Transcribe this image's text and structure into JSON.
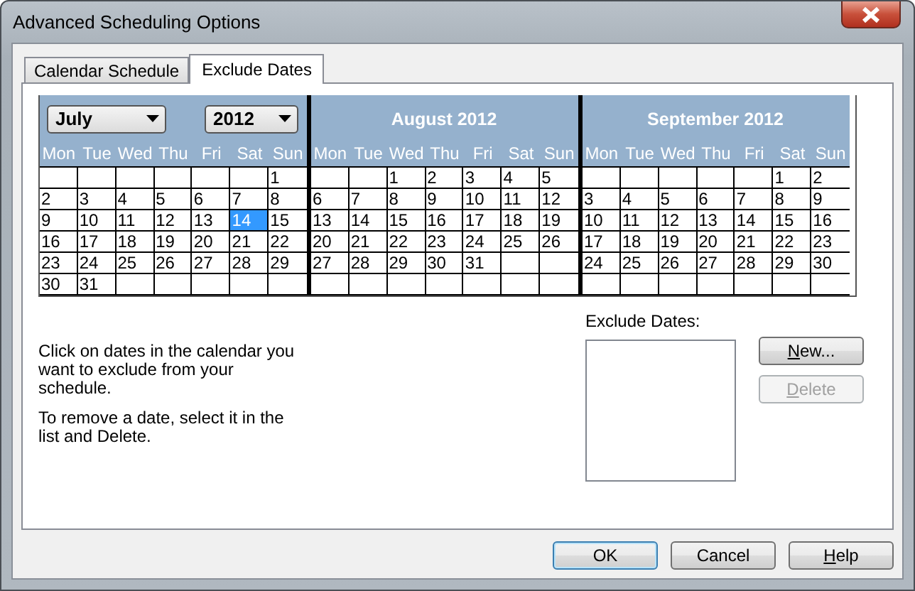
{
  "window": {
    "title": "Advanced Scheduling Options"
  },
  "tabs": [
    {
      "label": "Calendar Schedule",
      "selected": false
    },
    {
      "label": "Exclude Dates",
      "selected": true
    }
  ],
  "calendar": {
    "months": [
      {
        "kind": "picker",
        "month_dropdown": "July",
        "year_dropdown": "2012",
        "weekdays": [
          "Mon",
          "Tue",
          "Wed",
          "Thu",
          "Fri",
          "Sat",
          "Sun"
        ],
        "weeks": [
          [
            {
              "kind": "blank"
            },
            {
              "kind": "blank"
            },
            {
              "kind": "blank"
            },
            {
              "kind": "blank"
            },
            {
              "kind": "blank"
            },
            {
              "kind": "blank"
            },
            {
              "kind": "day",
              "d": "1",
              "selected": false
            }
          ],
          [
            {
              "kind": "day",
              "d": "2",
              "selected": false
            },
            {
              "kind": "day",
              "d": "3",
              "selected": false
            },
            {
              "kind": "day",
              "d": "4",
              "selected": false
            },
            {
              "kind": "day",
              "d": "5",
              "selected": false
            },
            {
              "kind": "day",
              "d": "6",
              "selected": false
            },
            {
              "kind": "day",
              "d": "7",
              "selected": false
            },
            {
              "kind": "day",
              "d": "8",
              "selected": false
            }
          ],
          [
            {
              "kind": "day",
              "d": "9",
              "selected": false
            },
            {
              "kind": "day",
              "d": "10",
              "selected": false
            },
            {
              "kind": "day",
              "d": "11",
              "selected": false
            },
            {
              "kind": "day",
              "d": "12",
              "selected": false
            },
            {
              "kind": "day",
              "d": "13",
              "selected": false
            },
            {
              "kind": "day",
              "d": "14",
              "selected": true
            },
            {
              "kind": "day",
              "d": "15",
              "selected": false
            }
          ],
          [
            {
              "kind": "day",
              "d": "16",
              "selected": false
            },
            {
              "kind": "day",
              "d": "17",
              "selected": false
            },
            {
              "kind": "day",
              "d": "18",
              "selected": false
            },
            {
              "kind": "day",
              "d": "19",
              "selected": false
            },
            {
              "kind": "day",
              "d": "20",
              "selected": false
            },
            {
              "kind": "day",
              "d": "21",
              "selected": false
            },
            {
              "kind": "day",
              "d": "22",
              "selected": false
            }
          ],
          [
            {
              "kind": "day",
              "d": "23",
              "selected": false
            },
            {
              "kind": "day",
              "d": "24",
              "selected": false
            },
            {
              "kind": "day",
              "d": "25",
              "selected": false
            },
            {
              "kind": "day",
              "d": "26",
              "selected": false
            },
            {
              "kind": "day",
              "d": "27",
              "selected": false
            },
            {
              "kind": "day",
              "d": "28",
              "selected": false
            },
            {
              "kind": "day",
              "d": "29",
              "selected": false
            }
          ],
          [
            {
              "kind": "day",
              "d": "30",
              "selected": false
            },
            {
              "kind": "day",
              "d": "31",
              "selected": false
            },
            {
              "kind": "blank"
            },
            {
              "kind": "blank"
            },
            {
              "kind": "blank"
            },
            {
              "kind": "blank"
            },
            {
              "kind": "blank"
            }
          ]
        ]
      },
      {
        "kind": "titled",
        "title": "August 2012",
        "weekdays": [
          "Mon",
          "Tue",
          "Wed",
          "Thu",
          "Fri",
          "Sat",
          "Sun"
        ],
        "weeks": [
          [
            {
              "kind": "blank"
            },
            {
              "kind": "blank"
            },
            {
              "kind": "day",
              "d": "1",
              "selected": false
            },
            {
              "kind": "day",
              "d": "2",
              "selected": false
            },
            {
              "kind": "day",
              "d": "3",
              "selected": false
            },
            {
              "kind": "day",
              "d": "4",
              "selected": false
            },
            {
              "kind": "day",
              "d": "5",
              "selected": false
            }
          ],
          [
            {
              "kind": "day",
              "d": "6",
              "selected": false
            },
            {
              "kind": "day",
              "d": "7",
              "selected": false
            },
            {
              "kind": "day",
              "d": "8",
              "selected": false
            },
            {
              "kind": "day",
              "d": "9",
              "selected": false
            },
            {
              "kind": "day",
              "d": "10",
              "selected": false
            },
            {
              "kind": "day",
              "d": "11",
              "selected": false
            },
            {
              "kind": "day",
              "d": "12",
              "selected": false
            }
          ],
          [
            {
              "kind": "day",
              "d": "13",
              "selected": false
            },
            {
              "kind": "day",
              "d": "14",
              "selected": false
            },
            {
              "kind": "day",
              "d": "15",
              "selected": false
            },
            {
              "kind": "day",
              "d": "16",
              "selected": false
            },
            {
              "kind": "day",
              "d": "17",
              "selected": false
            },
            {
              "kind": "day",
              "d": "18",
              "selected": false
            },
            {
              "kind": "day",
              "d": "19",
              "selected": false
            }
          ],
          [
            {
              "kind": "day",
              "d": "20",
              "selected": false
            },
            {
              "kind": "day",
              "d": "21",
              "selected": false
            },
            {
              "kind": "day",
              "d": "22",
              "selected": false
            },
            {
              "kind": "day",
              "d": "23",
              "selected": false
            },
            {
              "kind": "day",
              "d": "24",
              "selected": false
            },
            {
              "kind": "day",
              "d": "25",
              "selected": false
            },
            {
              "kind": "day",
              "d": "26",
              "selected": false
            }
          ],
          [
            {
              "kind": "day",
              "d": "27",
              "selected": false
            },
            {
              "kind": "day",
              "d": "28",
              "selected": false
            },
            {
              "kind": "day",
              "d": "29",
              "selected": false
            },
            {
              "kind": "day",
              "d": "30",
              "selected": false
            },
            {
              "kind": "day",
              "d": "31",
              "selected": false
            },
            {
              "kind": "blank"
            },
            {
              "kind": "blank"
            }
          ],
          [
            {
              "kind": "blank"
            },
            {
              "kind": "blank"
            },
            {
              "kind": "blank"
            },
            {
              "kind": "blank"
            },
            {
              "kind": "blank"
            },
            {
              "kind": "blank"
            },
            {
              "kind": "blank"
            }
          ]
        ]
      },
      {
        "kind": "titled",
        "title": "September 2012",
        "weekdays": [
          "Mon",
          "Tue",
          "Wed",
          "Thu",
          "Fri",
          "Sat",
          "Sun"
        ],
        "weeks": [
          [
            {
              "kind": "blank"
            },
            {
              "kind": "blank"
            },
            {
              "kind": "blank"
            },
            {
              "kind": "blank"
            },
            {
              "kind": "blank"
            },
            {
              "kind": "day",
              "d": "1",
              "selected": false
            },
            {
              "kind": "day",
              "d": "2",
              "selected": false
            }
          ],
          [
            {
              "kind": "day",
              "d": "3",
              "selected": false
            },
            {
              "kind": "day",
              "d": "4",
              "selected": false
            },
            {
              "kind": "day",
              "d": "5",
              "selected": false
            },
            {
              "kind": "day",
              "d": "6",
              "selected": false
            },
            {
              "kind": "day",
              "d": "7",
              "selected": false
            },
            {
              "kind": "day",
              "d": "8",
              "selected": false
            },
            {
              "kind": "day",
              "d": "9",
              "selected": false
            }
          ],
          [
            {
              "kind": "day",
              "d": "10",
              "selected": false
            },
            {
              "kind": "day",
              "d": "11",
              "selected": false
            },
            {
              "kind": "day",
              "d": "12",
              "selected": false
            },
            {
              "kind": "day",
              "d": "13",
              "selected": false
            },
            {
              "kind": "day",
              "d": "14",
              "selected": false
            },
            {
              "kind": "day",
              "d": "15",
              "selected": false
            },
            {
              "kind": "day",
              "d": "16",
              "selected": false
            }
          ],
          [
            {
              "kind": "day",
              "d": "17",
              "selected": false
            },
            {
              "kind": "day",
              "d": "18",
              "selected": false
            },
            {
              "kind": "day",
              "d": "19",
              "selected": false
            },
            {
              "kind": "day",
              "d": "20",
              "selected": false
            },
            {
              "kind": "day",
              "d": "21",
              "selected": false
            },
            {
              "kind": "day",
              "d": "22",
              "selected": false
            },
            {
              "kind": "day",
              "d": "23",
              "selected": false
            }
          ],
          [
            {
              "kind": "day",
              "d": "24",
              "selected": false
            },
            {
              "kind": "day",
              "d": "25",
              "selected": false
            },
            {
              "kind": "day",
              "d": "26",
              "selected": false
            },
            {
              "kind": "day",
              "d": "27",
              "selected": false
            },
            {
              "kind": "day",
              "d": "28",
              "selected": false
            },
            {
              "kind": "day",
              "d": "29",
              "selected": false
            },
            {
              "kind": "day",
              "d": "30",
              "selected": false
            }
          ],
          [
            {
              "kind": "blank"
            },
            {
              "kind": "blank"
            },
            {
              "kind": "blank"
            },
            {
              "kind": "blank"
            },
            {
              "kind": "blank"
            },
            {
              "kind": "blank"
            },
            {
              "kind": "blank"
            }
          ]
        ]
      }
    ]
  },
  "instructions": [
    "Click on dates in the calendar you want to exclude from your schedule.",
    "To remove a date, select it in the list and Delete."
  ],
  "exclude_list": {
    "label": "Exclude Dates:"
  },
  "side_buttons": [
    {
      "label": "New...",
      "underline_first": true,
      "disabled": false
    },
    {
      "label": "Delete",
      "underline_first": true,
      "disabled": true
    }
  ],
  "footer_buttons": [
    {
      "label": "OK",
      "underline_first": false,
      "default": true
    },
    {
      "label": "Cancel",
      "underline_first": false,
      "default": false
    },
    {
      "label": "Help",
      "underline_first": true,
      "default": false
    }
  ]
}
